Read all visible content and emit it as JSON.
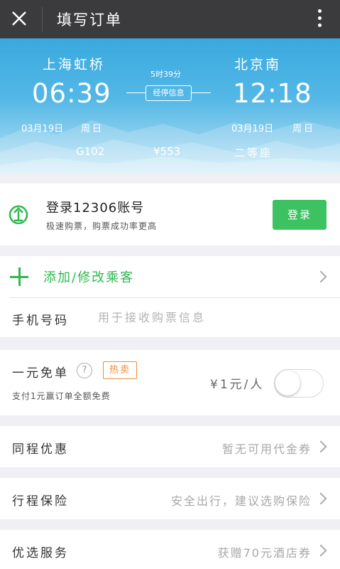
{
  "header": {
    "title": "填写订单",
    "close_icon": "close-icon",
    "more_icon": "more-vertical-icon"
  },
  "trip": {
    "from_station": "上海虹桥",
    "to_station": "北京南",
    "depart_time": "06:39",
    "arrive_time": "12:18",
    "duration": "5时39分",
    "stops_button": "经停信息",
    "depart_date": "03月19日",
    "depart_weekday": "周日",
    "arrive_date": "03月19日",
    "arrive_weekday": "周日",
    "train_no": "G102",
    "price": "¥553",
    "seat_class": "二等座"
  },
  "login": {
    "title": "登录12306账号",
    "subtitle": "极速购票，购票成功率更高",
    "button": "登录",
    "icon": "railway-logo-icon"
  },
  "passenger": {
    "add_label": "添加/修改乘客",
    "phone_label": "手机号码",
    "phone_placeholder": "用于接收购票信息",
    "phone_value": ""
  },
  "free_order": {
    "title": "一元免单",
    "hot_badge": "热卖",
    "subtitle": "支付1元赢订单全额免费",
    "price": "¥1元/人",
    "toggle_on": false
  },
  "rows": [
    {
      "label": "同程优惠",
      "value": "暂无可用代金券"
    },
    {
      "label": "行程保险",
      "value": "安全出行，建议选购保险"
    },
    {
      "label": "优选服务",
      "value": "获赠70元酒店券"
    }
  ],
  "colors": {
    "accent_green": "#3cc260",
    "hot_orange": "#f08a3c",
    "topbar": "#3b3b3d",
    "hero_blue": "#39a9df"
  }
}
